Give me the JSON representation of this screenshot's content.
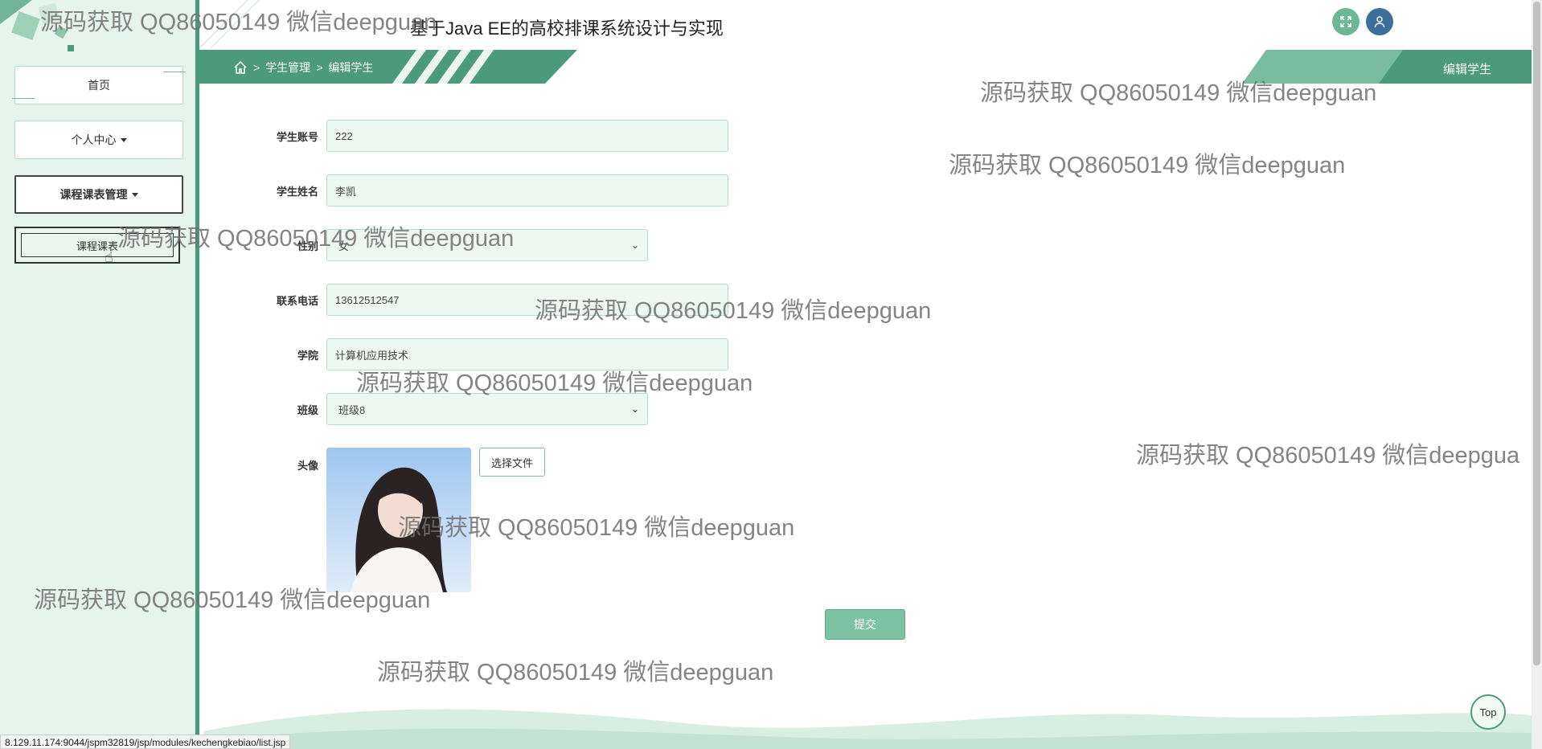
{
  "header": {
    "title": "基于Java EE的高校排课系统设计与实现",
    "fullscreen_icon": "expand-icon",
    "user_icon": "user-icon",
    "accent_color": "#4b9a7b"
  },
  "sidebar": {
    "items": [
      {
        "label": "首页"
      },
      {
        "label": "个人中心"
      },
      {
        "label": "课程课表管理"
      },
      {
        "label": "课程课表"
      }
    ]
  },
  "breadcrumb": {
    "home_icon": "home-icon",
    "sep": ">",
    "level1": "学生管理",
    "level2": "编辑学生"
  },
  "page": {
    "tab_title": "编辑学生"
  },
  "form": {
    "account": {
      "label": "学生账号",
      "value": "222"
    },
    "name": {
      "label": "学生姓名",
      "value": "李凯"
    },
    "gender": {
      "label": "性别",
      "value": "女"
    },
    "phone": {
      "label": "联系电话",
      "value": "13612512547"
    },
    "college": {
      "label": "学院",
      "value": "计算机应用技术"
    },
    "class": {
      "label": "班级",
      "value": "班级8"
    },
    "avatar": {
      "label": "头像",
      "choose_file": "选择文件"
    },
    "submit": "提交"
  },
  "top_button": "Top",
  "status_url": "8.129.11.174:9044/jspm32819/jsp/modules/kechengkebiao/list.jsp",
  "watermarks": [
    "源码获取 QQ86050149 微信deepguan",
    "源码获取 QQ86050149 微信deepguan",
    "源码获取 QQ86050149 微信deepguan",
    "源码获取 QQ86050149 微信deepguan",
    "源码获取 QQ86050149 微信deepguan",
    "源码获取 QQ86050149 微信deepguan",
    "源码获取 QQ86050149 微信deepgua",
    "源码获取 QQ86050149 微信deepguan",
    "源码获取 QQ86050149 微信deepguan",
    "源码获取 QQ86050149 微信deepguan"
  ]
}
